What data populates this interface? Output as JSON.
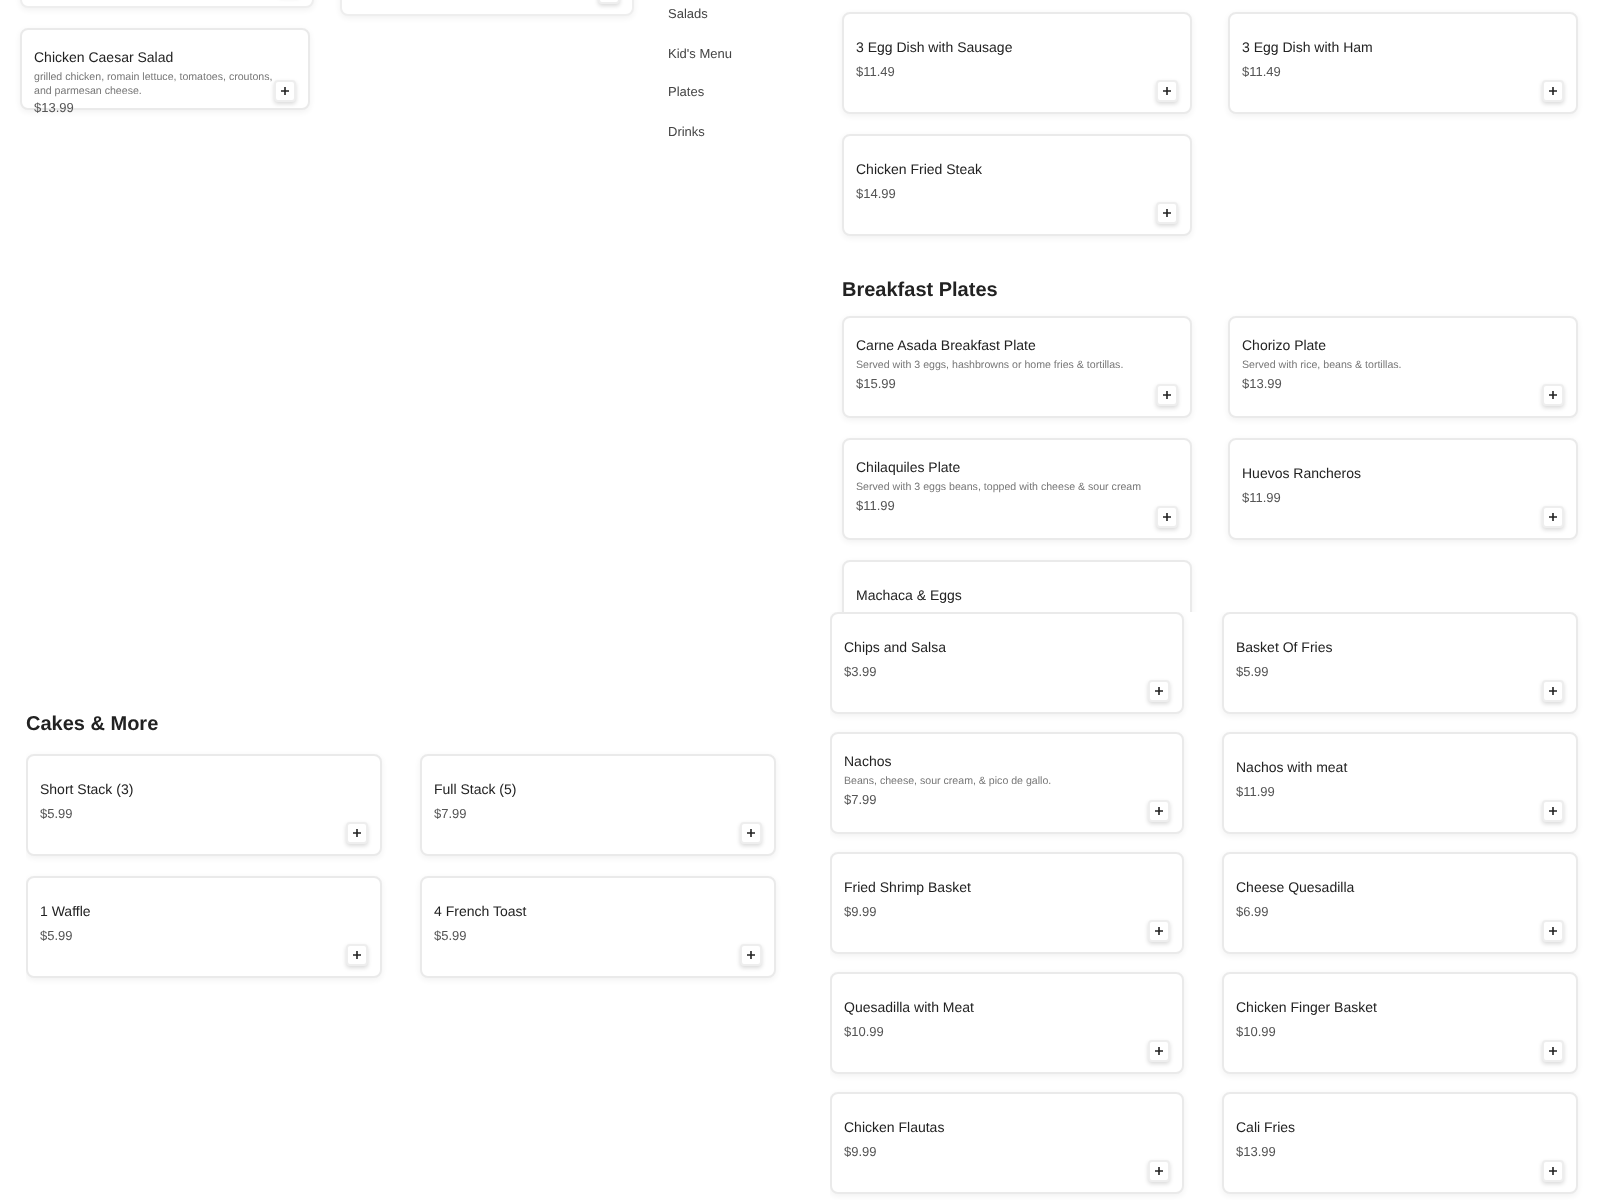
{
  "salads": {
    "items": [
      {
        "name": "Chicken Caesar Salad",
        "description": "grilled chicken, romain lettuce, tomatoes, croutons, and parmesan cheese.",
        "price": "$13.99"
      }
    ]
  },
  "category_nav": {
    "items": [
      "Salads",
      "Kid's Menu",
      "Plates",
      "Drinks"
    ]
  },
  "egg_dishes": {
    "items": [
      {
        "name": "3 Egg Dish with Sausage",
        "price": "$11.49"
      },
      {
        "name": "3 Egg Dish with Ham",
        "price": "$11.49"
      },
      {
        "name": "Chicken Fried Steak",
        "price": "$14.99"
      }
    ]
  },
  "breakfast_plates": {
    "title": "Breakfast Plates",
    "items": [
      {
        "name": "Carne Asada Breakfast Plate",
        "description": "Served with 3 eggs, hashbrowns or home fries & tortillas.",
        "price": "$15.99"
      },
      {
        "name": "Chorizo Plate",
        "description": "Served with rice, beans & tortillas.",
        "price": "$13.99"
      },
      {
        "name": "Chilaquiles Plate",
        "description": "Served with 3 eggs beans, topped with cheese & sour cream",
        "price": "$11.99"
      },
      {
        "name": "Huevos Rancheros",
        "price": "$11.99"
      },
      {
        "name": "Machaca & Eggs"
      }
    ]
  },
  "cakes": {
    "title": "Cakes & More",
    "items": [
      {
        "name": "Short Stack (3)",
        "price": "$5.99"
      },
      {
        "name": "Full Stack (5)",
        "price": "$7.99"
      },
      {
        "name": "1 Waffle",
        "price": "$5.99"
      },
      {
        "name": "4 French Toast",
        "price": "$5.99"
      }
    ]
  },
  "appetizers": {
    "items": [
      {
        "name": "Chips and Salsa",
        "price": "$3.99"
      },
      {
        "name": "Basket Of Fries",
        "price": "$5.99"
      },
      {
        "name": "Nachos",
        "description": "Beans, cheese, sour cream, & pico de gallo.",
        "price": "$7.99"
      },
      {
        "name": "Nachos with meat",
        "price": "$11.99"
      },
      {
        "name": "Fried Shrimp Basket",
        "price": "$9.99"
      },
      {
        "name": "Cheese Quesadilla",
        "price": "$6.99"
      },
      {
        "name": "Quesadilla with Meat",
        "price": "$10.99"
      },
      {
        "name": "Chicken Finger Basket",
        "price": "$10.99"
      },
      {
        "name": "Chicken Flautas",
        "price": "$9.99"
      },
      {
        "name": "Cali Fries",
        "price": "$13.99"
      }
    ]
  }
}
